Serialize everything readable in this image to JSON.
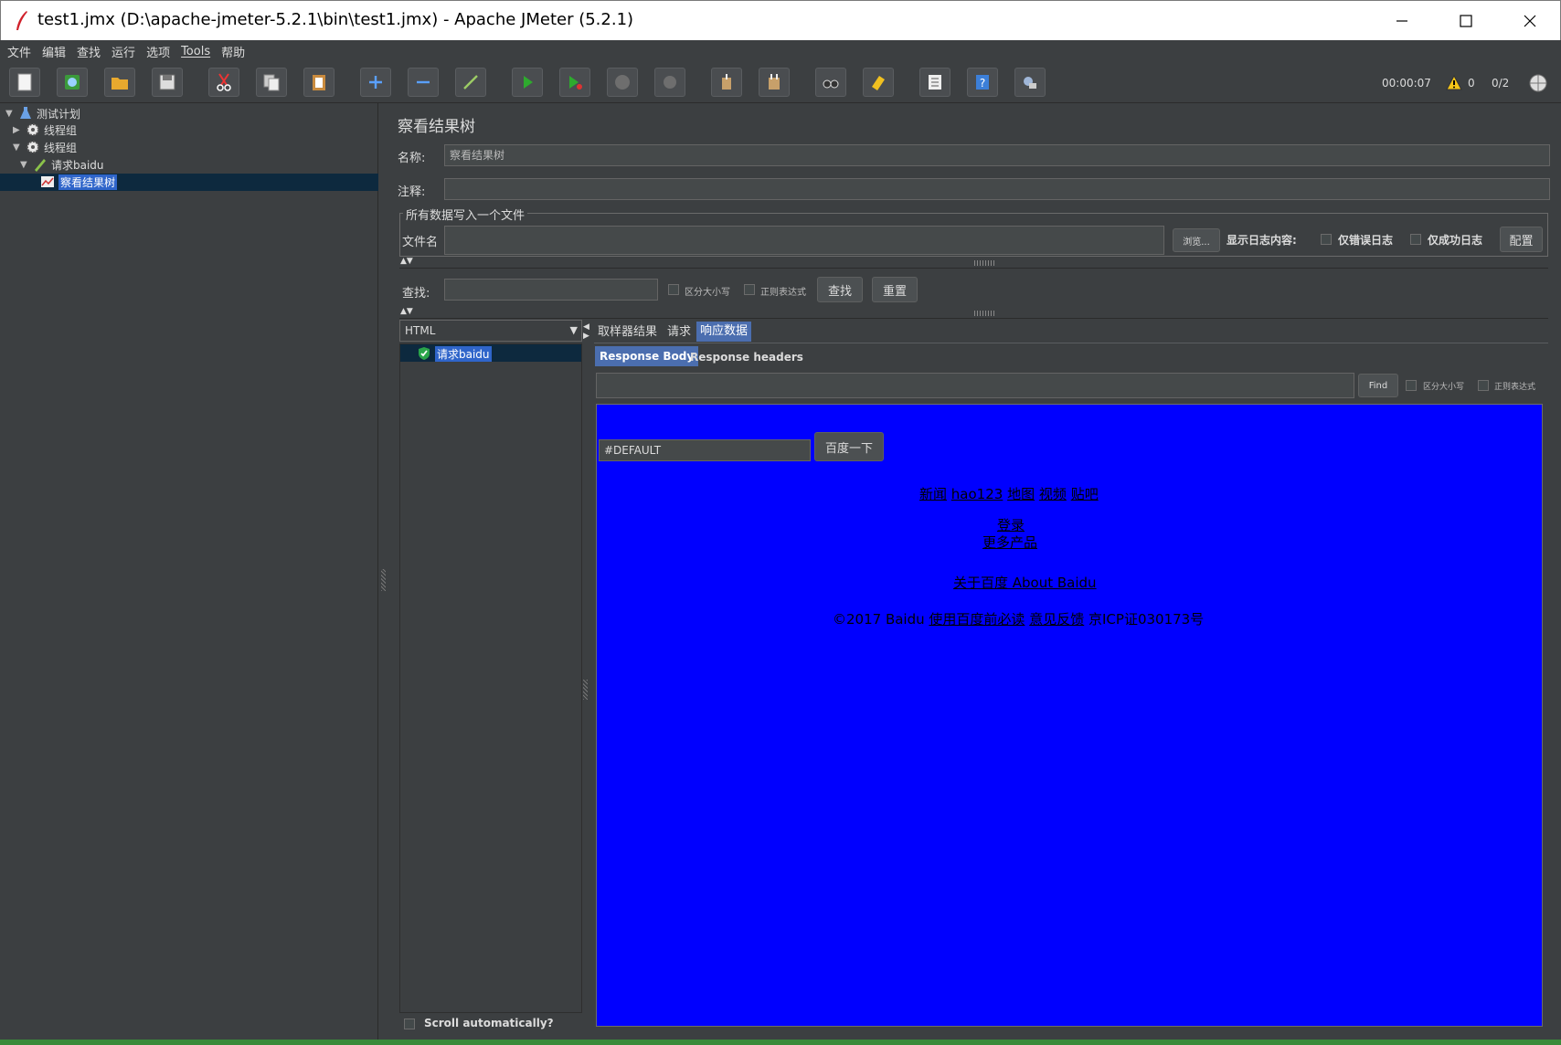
{
  "window": {
    "title": "test1.jmx (D:\\apache-jmeter-5.2.1\\bin\\test1.jmx) - Apache JMeter (5.2.1)"
  },
  "menu": [
    "文件",
    "编辑",
    "查找",
    "运行",
    "选项",
    "Tools",
    "帮助"
  ],
  "toolbar": {
    "elapsed": "00:00:07",
    "warnings": "0",
    "threads": "0/2",
    "buttons": [
      "new",
      "templates",
      "open",
      "save",
      "cut",
      "copy",
      "paste",
      "expand",
      "collapse",
      "toggle",
      "start",
      "start-no-pauses",
      "stop",
      "shutdown",
      "clear",
      "clear-all",
      "search",
      "reset-search",
      "function-helper",
      "help",
      "remote"
    ]
  },
  "tree": {
    "items": [
      {
        "label": "测试计划",
        "icon": "flask-icon",
        "expanded": true
      },
      {
        "label": "线程组",
        "icon": "gear-icon",
        "expanded": false
      },
      {
        "label": "线程组",
        "icon": "gear-icon",
        "expanded": true
      },
      {
        "label": "请求baidu",
        "icon": "pen-icon",
        "expanded": true
      },
      {
        "label": "察看结果树",
        "icon": "chart-icon",
        "selected": true
      }
    ]
  },
  "panel": {
    "title": "察看结果树",
    "name_label": "名称:",
    "name_value": "察看结果树",
    "comment_label": "注释:",
    "comment_value": "",
    "file_group": "所有数据写入一个文件",
    "filename_label": "文件名",
    "filename_value": "",
    "browse": "浏览...",
    "log_label": "显示日志内容:",
    "errors_only": "仅错误日志",
    "success_only": "仅成功日志",
    "configure": "配置",
    "search_label": "查找:",
    "search_value": "",
    "case_sensitive": "区分大小写",
    "regex": "正则表达式",
    "search_btn": "查找",
    "reset_btn": "重置"
  },
  "results": {
    "renderer": "HTML",
    "items": [
      {
        "label": "请求baidu",
        "status": "success"
      }
    ],
    "scroll_auto": "Scroll automatically?"
  },
  "tabs": {
    "main": [
      "取样器结果",
      "请求",
      "响应数据"
    ],
    "active_main": 2,
    "sub": [
      "Response Body",
      "Response headers"
    ],
    "active_sub": 0,
    "find_btn": "Find",
    "find_case": "区分大小写",
    "find_regex": "正则表达式"
  },
  "preview": {
    "background": "#0000ff",
    "input_value": "#DEFAULT",
    "submit": "百度一下",
    "links_row": [
      "新闻",
      "hao123",
      "地图",
      "视频",
      "贴吧"
    ],
    "login": "登录",
    "more": "更多产品",
    "about": "关于百度 About Baidu",
    "copyright_prefix": "©2017 Baidu",
    "copyright_links": [
      "使用百度前必读",
      "意见反馈"
    ],
    "icp": "京ICP证030173号"
  }
}
